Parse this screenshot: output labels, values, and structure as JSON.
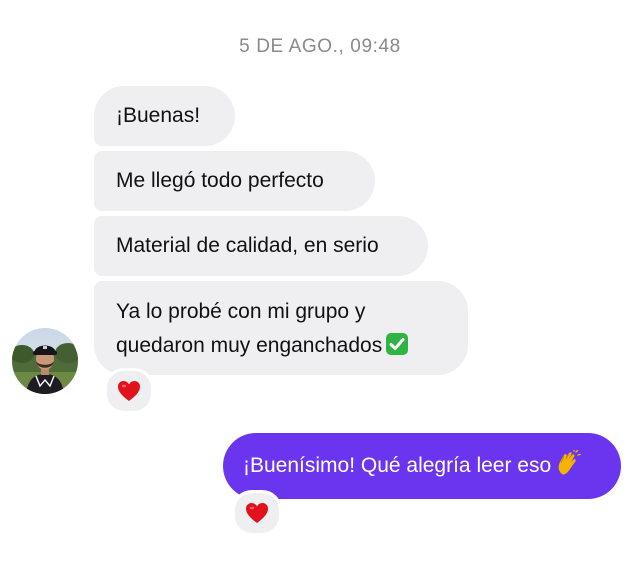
{
  "chat": {
    "timestamp": "5 DE AGO., 09:48",
    "incoming": [
      {
        "lines": [
          "¡Buenas!"
        ]
      },
      {
        "lines": [
          "Me llegó todo perfecto"
        ]
      },
      {
        "lines": [
          "Material de calidad, en serio"
        ]
      },
      {
        "lines": [
          "Ya lo probé con mi grupo y",
          "quedaron muy enganchados"
        ],
        "trailing_emoji": "check-mark-emoji",
        "reaction": "heart-emoji"
      }
    ],
    "outgoing": [
      {
        "text": "¡Buenísimo! Qué alegría leer eso",
        "trailing_emoji": "clapping-hands-emoji",
        "reaction": "heart-emoji"
      }
    ]
  },
  "colors": {
    "incoming_bubble": "#efeff2",
    "outgoing_bubble": "#6b35f0",
    "timestamp_text": "#8a8a8e",
    "reaction_heart": "#e0131d",
    "check_emoji": "#2fb344"
  }
}
